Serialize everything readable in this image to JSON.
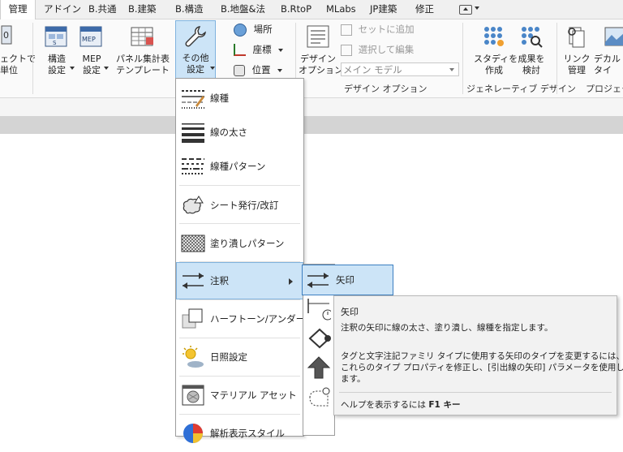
{
  "tabs": [
    "管理",
    "アドイン",
    "B.共通",
    "B.建築",
    "B.構造",
    "B.地盤&法",
    "B.RtoP",
    "MLabs",
    "JP建築",
    "修正"
  ],
  "ribbon": {
    "project_units_label": "ェクトで\n単位",
    "structure_settings": "構造\n設定",
    "mep_settings": "MEP\n設定",
    "panel_schedule": "パネル集計表\nテンプレート",
    "other_settings": "その他\n設定",
    "location": "場所",
    "coordinates": "座標",
    "position": "位置",
    "design_options": "デザイン\nオプション",
    "add_to_set": "セットに追加",
    "pick_to_edit": "選択して編集",
    "main_model": "メイン モデル",
    "group_design_options": "デザイン オプション",
    "study_create": "スタディを\n作成",
    "explore_results": "成果を\n検討",
    "group_generative": "ジェネレーティブ デザイン",
    "manage_links": "リンク\n管理",
    "decal_types": "デカル\nタイ",
    "group_project": "プロジェク"
  },
  "menu": {
    "items": [
      "線種",
      "線の太さ",
      "線種パターン",
      "シート発行/改訂",
      "塗り潰しパターン",
      "注釈",
      "ハーフトーン/アンダーレイ",
      "日照設定",
      "マテリアル アセット",
      "解析表示スタイル"
    ]
  },
  "submenu": {
    "highlighted": "矢印"
  },
  "tooltip": {
    "title": "矢印",
    "line1": "注釈の矢印に線の太さ、塗り潰し、線種を指定します。",
    "line2": "タグと文字注記ファミリ タイプに使用する矢印のタイプを変更するには、",
    "line3": "これらのタイプ プロパティを修正し、[引出線の矢印] パラメータを使用し",
    "line4": "ます。",
    "help_prefix": "ヘルプを表示するには ",
    "help_key": "F1 キー"
  },
  "colors": {
    "highlight": "#cce4f7",
    "highlight_border": "#3c7fc1",
    "accent_blue": "#1f5fa8"
  }
}
